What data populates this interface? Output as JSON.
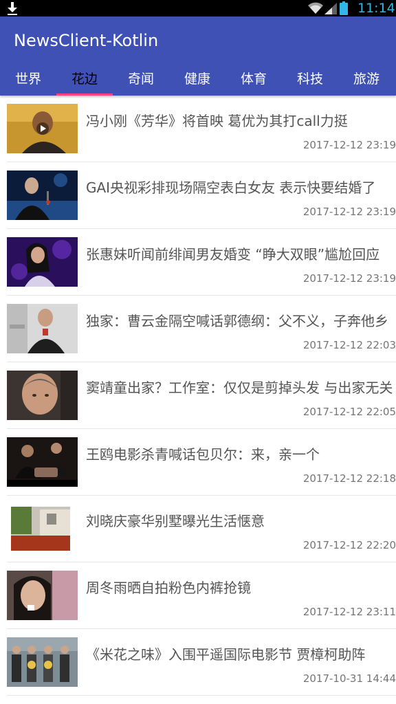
{
  "status_bar": {
    "time": "11:14"
  },
  "app": {
    "title": "NewsClient-Kotlin"
  },
  "tabs": [
    {
      "label": "世界"
    },
    {
      "label": "花边",
      "active": true
    },
    {
      "label": "奇闻"
    },
    {
      "label": "健康"
    },
    {
      "label": "体育"
    },
    {
      "label": "科技"
    },
    {
      "label": "旅游"
    }
  ],
  "news": [
    {
      "title": "冯小刚《芳华》将首映 葛优为其打call力挺",
      "time": "2017-12-12 23:19"
    },
    {
      "title": "GAI央视彩排现场隔空表白女友 表示快要结婚了",
      "time": "2017-12-12 23:19"
    },
    {
      "title": "张惠妹听闻前绯闻男友婚变 “睁大双眼”尴尬回应",
      "time": "2017-12-12 23:19"
    },
    {
      "title": "独家：曹云金隔空喊话郭德纲：父不义，子奔他乡",
      "time": "2017-12-12 22:03"
    },
    {
      "title": "窦靖童出家？工作室：仅仅是剪掉头发 与出家无关",
      "time": "2017-12-12 22:05"
    },
    {
      "title": "王鸥电影杀青喊话包贝尔：来，亲一个",
      "time": "2017-12-12 22:18"
    },
    {
      "title": "刘晓庆豪华别墅曝光生活惬意",
      "time": "2017-12-12 22:20"
    },
    {
      "title": "周冬雨晒自拍粉色内裤抢镜",
      "time": "2017-12-12 23:11"
    },
    {
      "title": "《米花之味》入围平遥国际电影节 贾樟柯助阵",
      "time": "2017-10-31 14:44"
    }
  ],
  "colors": {
    "primary": "#3f51b5",
    "accent": "#ff4081",
    "status_bar": "#000000",
    "status_icons": "#33b5e5"
  }
}
